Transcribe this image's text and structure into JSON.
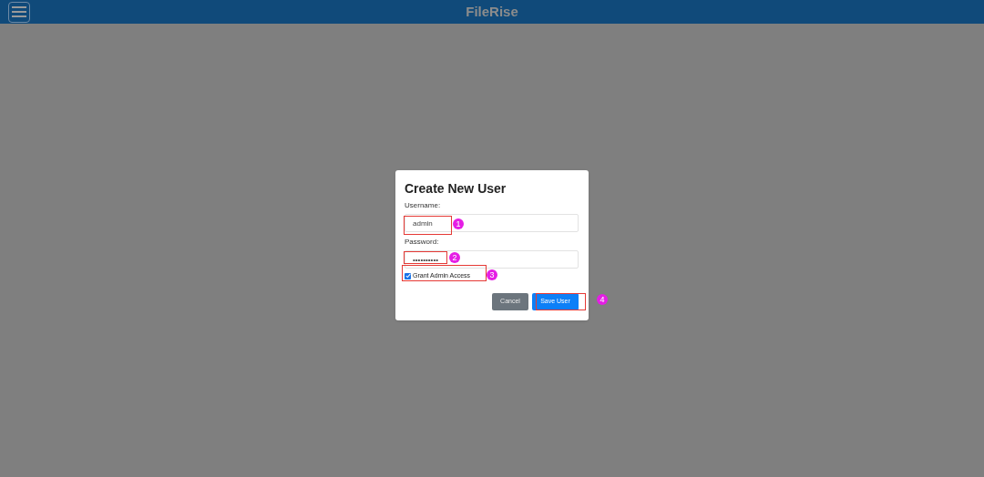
{
  "header": {
    "title": "FileRise"
  },
  "dialog": {
    "title": "Create New User",
    "fields": [
      {
        "label": "Username:",
        "value": "admin"
      },
      {
        "label": "Password:",
        "value": "••••••••••"
      }
    ],
    "admin_access": {
      "label": "Grant Admin Access",
      "checked": true
    },
    "buttons": [
      {
        "label": "Cancel",
        "kind": "secondary"
      },
      {
        "label": "Save User",
        "kind": "primary"
      }
    ]
  },
  "annotations": [
    {
      "label": "1"
    },
    {
      "label": "2"
    },
    {
      "label": "3"
    },
    {
      "label": "4"
    }
  ]
}
